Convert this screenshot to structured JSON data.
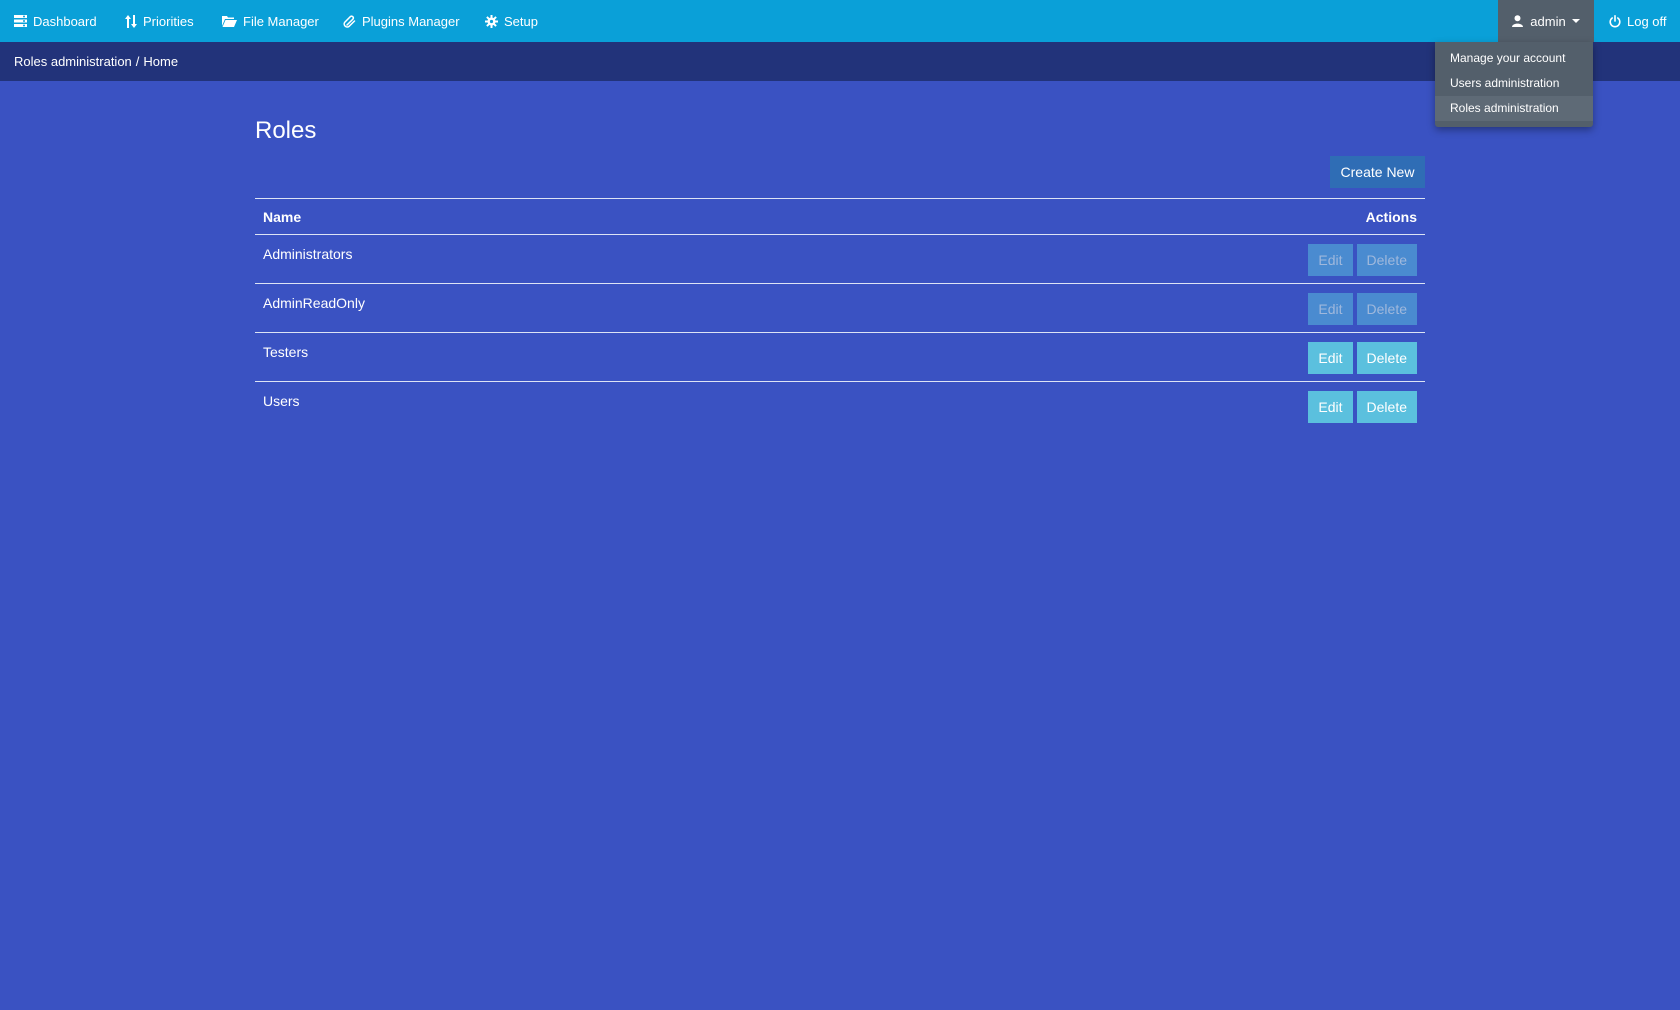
{
  "nav": {
    "items": [
      {
        "label": "Dashboard",
        "icon": "dashboard-icon"
      },
      {
        "label": "Priorities",
        "icon": "sort-arrows-icon"
      },
      {
        "label": "File Manager",
        "icon": "folder-open-icon"
      },
      {
        "label": "Plugins Manager",
        "icon": "paperclip-icon"
      },
      {
        "label": "Setup",
        "icon": "gear-icon"
      }
    ],
    "user_label": "admin",
    "logoff_label": "Log off"
  },
  "breadcrumb": {
    "section": "Roles administration",
    "separator": "/",
    "current": "Home"
  },
  "user_dropdown": {
    "items": [
      {
        "label": "Manage your account"
      },
      {
        "label": "Users administration"
      },
      {
        "label": "Roles administration",
        "active": true
      }
    ]
  },
  "main": {
    "title": "Roles",
    "create_label": "Create New",
    "table": {
      "headers": {
        "name": "Name",
        "actions": "Actions"
      },
      "rows": [
        {
          "name": "Administrators",
          "edit": "Edit",
          "delete": "Delete",
          "enabled": false
        },
        {
          "name": "AdminReadOnly",
          "edit": "Edit",
          "delete": "Delete",
          "enabled": false
        },
        {
          "name": "Testers",
          "edit": "Edit",
          "delete": "Delete",
          "enabled": true
        },
        {
          "name": "Users",
          "edit": "Edit",
          "delete": "Delete",
          "enabled": true
        }
      ]
    }
  },
  "colors": {
    "topbar": "#0aa0d8",
    "breadcrumb_bar": "#22337a",
    "background": "#3a52c2",
    "dropdown": "#535f6b",
    "primary_button": "#2f6db5",
    "info_button": "#5bc0de"
  }
}
